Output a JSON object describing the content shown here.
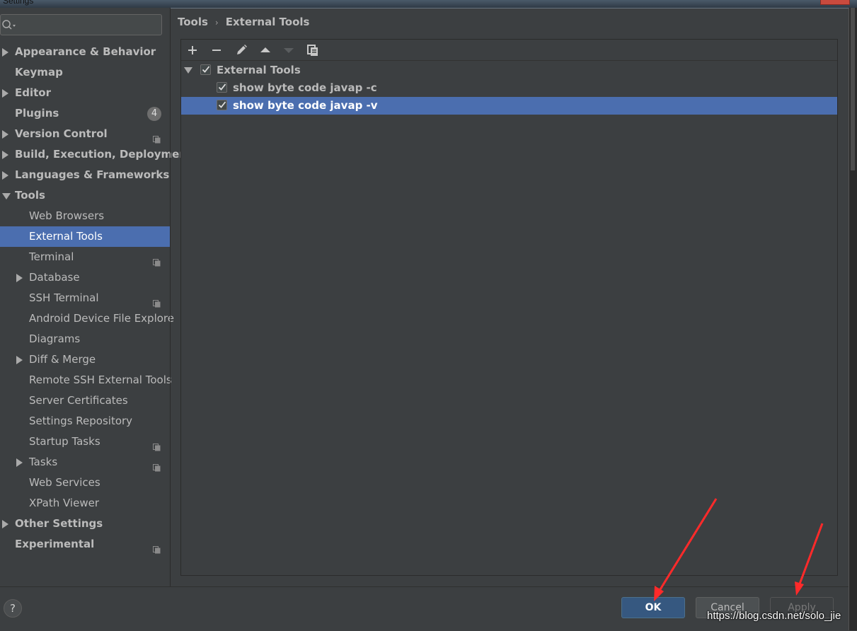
{
  "window": {
    "title": "Settings"
  },
  "search": {
    "placeholder": ""
  },
  "sidebar": {
    "items": [
      {
        "label": "Appearance & Behavior",
        "bold": true,
        "expand": "right"
      },
      {
        "label": "Keymap",
        "bold": true
      },
      {
        "label": "Editor",
        "bold": true,
        "expand": "right"
      },
      {
        "label": "Plugins",
        "bold": true,
        "badge": "4"
      },
      {
        "label": "Version Control",
        "bold": true,
        "expand": "right",
        "project_icon": "copy-icon"
      },
      {
        "label": "Build, Execution, Deployment",
        "bold": true,
        "expand": "right"
      },
      {
        "label": "Languages & Frameworks",
        "bold": true,
        "expand": "right"
      },
      {
        "label": "Tools",
        "bold": true,
        "expand": "down"
      },
      {
        "label": "Web Browsers"
      },
      {
        "label": "External Tools",
        "selected": true
      },
      {
        "label": "Terminal",
        "project_icon": "copy-icon"
      },
      {
        "label": "Database",
        "expand": "right"
      },
      {
        "label": "SSH Terminal",
        "project_icon": "copy-icon"
      },
      {
        "label": "Android Device File Explore"
      },
      {
        "label": "Diagrams"
      },
      {
        "label": "Diff & Merge",
        "expand": "right"
      },
      {
        "label": "Remote SSH External Tools"
      },
      {
        "label": "Server Certificates"
      },
      {
        "label": "Settings Repository"
      },
      {
        "label": "Startup Tasks",
        "project_icon": "copy-icon"
      },
      {
        "label": "Tasks",
        "expand": "right",
        "project_icon": "copy-icon"
      },
      {
        "label": "Web Services"
      },
      {
        "label": "XPath Viewer"
      },
      {
        "label": "Other Settings",
        "bold": true,
        "expand": "right"
      },
      {
        "label": "Experimental",
        "bold": true,
        "project_icon": "copy-icon"
      }
    ]
  },
  "breadcrumb": {
    "parent": "Tools",
    "separator": "›",
    "current": "External Tools"
  },
  "toolbar": {
    "buttons": [
      "add-icon",
      "remove-icon",
      "edit-icon",
      "move-up-icon",
      "move-down-icon",
      "copy-icon"
    ]
  },
  "tools_tree": {
    "group": {
      "label": "External Tools",
      "checked": true,
      "expanded": true
    },
    "items": [
      {
        "label": "show byte code javap -c",
        "checked": true
      },
      {
        "label": "show byte code javap -v",
        "checked": true,
        "selected": true
      }
    ]
  },
  "footer": {
    "help_label": "?",
    "ok_label": "OK",
    "cancel_label": "Cancel",
    "apply_label": "Apply",
    "apply_enabled": false
  },
  "watermark": "https://blog.csdn.net/solo_jie",
  "colors": {
    "background": "#3c3f41",
    "selection": "#4b6eaf",
    "annotation_arrow": "#ff2a2a",
    "ok_button": "#365880"
  }
}
